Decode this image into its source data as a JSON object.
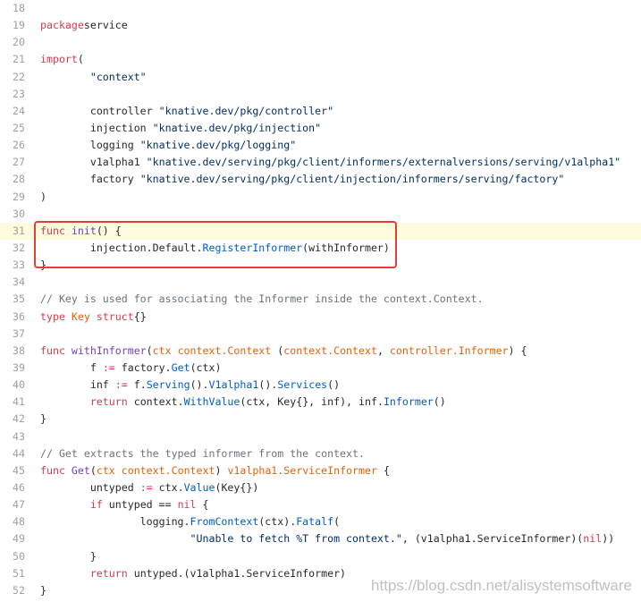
{
  "lines": [
    {
      "n": "18",
      "tokens": []
    },
    {
      "n": "19",
      "tokens": [
        [
          "kw",
          "package"
        ],
        [
          "",
          "service"
        ]
      ]
    },
    {
      "n": "20",
      "tokens": []
    },
    {
      "n": "21",
      "tokens": [
        [
          "kw",
          "import"
        ],
        [
          "",
          "("
        ]
      ]
    },
    {
      "n": "22",
      "tokens": [
        [
          "",
          "        "
        ],
        [
          "str",
          "\"context\""
        ]
      ]
    },
    {
      "n": "23",
      "tokens": []
    },
    {
      "n": "24",
      "tokens": [
        [
          "",
          "        controller "
        ],
        [
          "str",
          "\"knative.dev/pkg/controller\""
        ]
      ]
    },
    {
      "n": "25",
      "tokens": [
        [
          "",
          "        injection "
        ],
        [
          "str",
          "\"knative.dev/pkg/injection\""
        ]
      ]
    },
    {
      "n": "26",
      "tokens": [
        [
          "",
          "        logging "
        ],
        [
          "str",
          "\"knative.dev/pkg/logging\""
        ]
      ]
    },
    {
      "n": "27",
      "tokens": [
        [
          "",
          "        v1alpha1 "
        ],
        [
          "str",
          "\"knative.dev/serving/pkg/client/informers/externalversions/serving/v1alpha1\""
        ]
      ]
    },
    {
      "n": "28",
      "tokens": [
        [
          "",
          "        factory "
        ],
        [
          "str",
          "\"knative.dev/serving/pkg/client/injection/informers/serving/factory\""
        ]
      ]
    },
    {
      "n": "29",
      "tokens": [
        [
          "",
          ")"
        ]
      ]
    },
    {
      "n": "30",
      "tokens": []
    },
    {
      "n": "31",
      "tokens": [
        [
          "kw",
          "func"
        ],
        [
          "",
          ""
        ],
        [
          "fn",
          "init"
        ],
        [
          "",
          "() {"
        ]
      ],
      "hl": true
    },
    {
      "n": "32",
      "tokens": [
        [
          "",
          "        injection.Default."
        ],
        [
          "call",
          "RegisterInformer"
        ],
        [
          "",
          "(withInformer)"
        ]
      ]
    },
    {
      "n": "33",
      "tokens": [
        [
          "",
          "}"
        ]
      ]
    },
    {
      "n": "34",
      "tokens": []
    },
    {
      "n": "35",
      "tokens": [
        [
          "com",
          "// Key is used for associating the Informer inside the context.Context."
        ]
      ]
    },
    {
      "n": "36",
      "tokens": [
        [
          "kw",
          "type"
        ],
        [
          "",
          ""
        ],
        [
          "typ",
          "Key"
        ],
        [
          "",
          ""
        ],
        [
          "kw",
          "struct"
        ],
        [
          "",
          "{}"
        ]
      ]
    },
    {
      "n": "37",
      "tokens": []
    },
    {
      "n": "38",
      "tokens": [
        [
          "kw",
          "func"
        ],
        [
          "",
          ""
        ],
        [
          "fn",
          "withInformer"
        ],
        [
          "",
          "("
        ],
        [
          "typ",
          "ctx context.Context"
        ],
        [
          "",
          " ("
        ],
        [
          "typ",
          "context.Context"
        ],
        [
          "",
          ", "
        ],
        [
          "typ",
          "controller.Informer"
        ],
        [
          "",
          ") {"
        ]
      ]
    },
    {
      "n": "39",
      "tokens": [
        [
          "",
          "        f "
        ],
        [
          "kw",
          ":="
        ],
        [
          "",
          " factory."
        ],
        [
          "call",
          "Get"
        ],
        [
          "",
          "(ctx)"
        ]
      ]
    },
    {
      "n": "40",
      "tokens": [
        [
          "",
          "        inf "
        ],
        [
          "kw",
          ":="
        ],
        [
          "",
          " f."
        ],
        [
          "call",
          "Serving"
        ],
        [
          "",
          "()."
        ],
        [
          "call",
          "V1alpha1"
        ],
        [
          "",
          "()."
        ],
        [
          "call",
          "Services"
        ],
        [
          "",
          "()"
        ]
      ]
    },
    {
      "n": "41",
      "tokens": [
        [
          "",
          "        "
        ],
        [
          "kw",
          "return"
        ],
        [
          "",
          " context."
        ],
        [
          "call",
          "WithValue"
        ],
        [
          "",
          "(ctx, Key{}, inf), inf."
        ],
        [
          "call",
          "Informer"
        ],
        [
          "",
          "()"
        ]
      ]
    },
    {
      "n": "42",
      "tokens": [
        [
          "",
          "}"
        ]
      ]
    },
    {
      "n": "43",
      "tokens": []
    },
    {
      "n": "44",
      "tokens": [
        [
          "com",
          "// Get extracts the typed informer from the context."
        ]
      ]
    },
    {
      "n": "45",
      "tokens": [
        [
          "kw",
          "func"
        ],
        [
          "",
          ""
        ],
        [
          "fn",
          "Get"
        ],
        [
          "",
          "("
        ],
        [
          "typ",
          "ctx context.Context"
        ],
        [
          "",
          ") "
        ],
        [
          "typ",
          "v1alpha1.ServiceInformer"
        ],
        [
          "",
          " {"
        ]
      ]
    },
    {
      "n": "46",
      "tokens": [
        [
          "",
          "        untyped "
        ],
        [
          "kw",
          ":="
        ],
        [
          "",
          " ctx."
        ],
        [
          "call",
          "Value"
        ],
        [
          "",
          "(Key{})"
        ]
      ]
    },
    {
      "n": "47",
      "tokens": [
        [
          "",
          "        "
        ],
        [
          "kw",
          "if"
        ],
        [
          "",
          " untyped == "
        ],
        [
          "kw",
          "nil"
        ],
        [
          "",
          " {"
        ]
      ]
    },
    {
      "n": "48",
      "tokens": [
        [
          "",
          "                logging."
        ],
        [
          "call",
          "FromContext"
        ],
        [
          "",
          "(ctx)."
        ],
        [
          "call",
          "Fatalf"
        ],
        [
          "",
          "("
        ]
      ]
    },
    {
      "n": "49",
      "tokens": [
        [
          "",
          "                        "
        ],
        [
          "str",
          "\"Unable to fetch %T from context.\""
        ],
        [
          "",
          ", (v1alpha1.ServiceInformer)("
        ],
        [
          "kw",
          "nil"
        ],
        [
          "",
          "))"
        ]
      ]
    },
    {
      "n": "50",
      "tokens": [
        [
          "",
          "        }"
        ]
      ]
    },
    {
      "n": "51",
      "tokens": [
        [
          "",
          "        "
        ],
        [
          "kw",
          "return"
        ],
        [
          "",
          " untyped.(v1alpha1.ServiceInformer)"
        ]
      ]
    },
    {
      "n": "52",
      "tokens": [
        [
          "",
          "}"
        ]
      ]
    }
  ],
  "watermark": "https://blog.csdn.net/alisystemsoftware",
  "colors": {
    "keyword": "#d73a49",
    "string": "#032f62",
    "function": "#6f42c1",
    "call": "#005cc5",
    "type": "#e36209",
    "comment": "#6a737d",
    "highlight_box": "#e0403a",
    "highlight_line": "#fffbdd"
  }
}
